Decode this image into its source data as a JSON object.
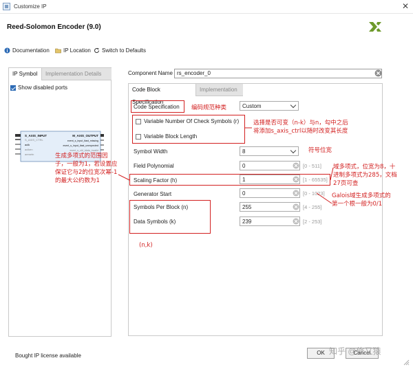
{
  "window": {
    "title": "Customize IP",
    "close_label": "✕"
  },
  "header": {
    "title": "Reed-Solomon Encoder (9.0)"
  },
  "toolbar": {
    "documentation": "Documentation",
    "ip_location": "IP Location",
    "switch_defaults": "Switch to Defaults"
  },
  "left_panel": {
    "tabs": [
      "IP Symbol",
      "Implementation Details"
    ],
    "show_disabled_label": "Show disabled ports",
    "show_disabled_checked": true,
    "symbol": {
      "left_ports": [
        "S_AXIS_INPUT",
        "S_AXIS_CTRL",
        "aclk",
        "aclken",
        "aresetn"
      ],
      "right_ports": [
        "M_AXIS_OUTPUT",
        "event_s_input_tlast_missing",
        "event_s_input_tlast_unexpected",
        "event_s_ctrl_tdata_invalid"
      ]
    }
  },
  "component": {
    "label": "Component Name",
    "value": "rs_encoder_0"
  },
  "right_panel": {
    "tabs": [
      "Code Block Specification",
      "Implementation"
    ],
    "code_spec_label": "Code Specification",
    "code_spec_value": "Custom",
    "variable_check_symbols_label": "Variable Number Of Check Symbols (r)",
    "variable_block_length_label": "Variable Block Length",
    "symbol_width_label": "Symbol Width",
    "symbol_width_value": "8",
    "field_polynomial_label": "Field Polynomial",
    "field_polynomial_value": "0",
    "field_polynomial_range": "[0 - 511]",
    "scaling_factor_label": "Scaling Factor (h)",
    "scaling_factor_value": "1",
    "scaling_factor_range": "[1 - 65535]",
    "generator_start_label": "Generator Start",
    "generator_start_value": "0",
    "generator_start_range": "[0 - 1023]",
    "symbols_per_block_label": "Symbols Per Block (n)",
    "symbols_per_block_value": "255",
    "symbols_per_block_range": "[4 - 255]",
    "data_symbols_label": "Data Symbols (k)",
    "data_symbols_value": "239",
    "data_symbols_range": "[2 - 253]"
  },
  "annotations": {
    "code_type": "编码规范种类",
    "variable_note_1": "选择是否可变（n-k）与n，勾中之后",
    "variable_note_2": "将添加s_axis_ctrl以随时改变其长度",
    "symbol_width_note": "符号位宽",
    "field_poly_note_1": "域多项式，位宽为8，十",
    "field_poly_note_2": "进制多项式为285，文档",
    "field_poly_note_3": "27页可查",
    "galois_note_1": "Galois域生成多项式的",
    "galois_note_2": "第一个根一般为0/1",
    "nk_note": "(n,k)",
    "scaling_note_1": "生成多项式的范围因",
    "scaling_note_2": "子，一般为1，若设置应",
    "scaling_note_3": "保证它与2的位宽次幂-1",
    "scaling_note_4": "的最大公约数为1"
  },
  "footer": {
    "license": "Bought IP license available",
    "ok": "OK",
    "cancel": "Cancel",
    "watermark": "知乎 @修又猿"
  },
  "colors": {
    "annotation_red": "#d21f1f",
    "logo_green": "#6e9a2c",
    "accent_blue": "#2d6bb5"
  }
}
